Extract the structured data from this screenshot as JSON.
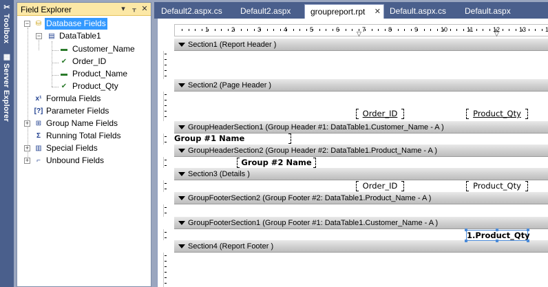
{
  "sidepanel": {
    "tabs": [
      {
        "label": "Toolbox",
        "icon": "toolbox-icon"
      },
      {
        "label": "Server Explorer",
        "icon": "server-explorer-icon"
      }
    ]
  },
  "explorer": {
    "title": "Field Explorer",
    "nodes": {
      "database_fields": "Database Fields",
      "datatable1": "DataTable1",
      "customer_name": "Customer_Name",
      "order_id": "Order_ID",
      "product_name": "Product_Name",
      "product_qty": "Product_Qty",
      "formula_fields": "Formula Fields",
      "parameter_fields": "Parameter Fields",
      "group_name_fields": "Group Name Fields",
      "running_total_fields": "Running Total Fields",
      "special_fields": "Special Fields",
      "unbound_fields": "Unbound Fields"
    },
    "buttons": {
      "dropdown": "▾",
      "pin": "ᚁ",
      "close": "✕"
    }
  },
  "tabs": [
    {
      "label": "Default2.aspx.cs",
      "active": false
    },
    {
      "label": "Default2.aspx",
      "active": false
    },
    {
      "label": "groupreport.rpt",
      "active": true
    },
    {
      "label": "Default.aspx.cs",
      "active": false
    },
    {
      "label": "Default.aspx",
      "active": false
    }
  ],
  "ruler": {
    "numbers": [
      "1",
      "2",
      "3",
      "4",
      "5",
      "6",
      "7",
      "8",
      "9",
      "10",
      "11",
      "12",
      "13",
      "14"
    ]
  },
  "sections": [
    "Section1 (Report Header )",
    "Section2 (Page Header )",
    "GroupHeaderSection1 (Group Header #1: DataTable1.Customer_Name - A )",
    "GroupHeaderSection2 (Group Header #2: DataTable1.Product_Name - A )",
    "Section3 (Details )",
    "GroupFooterSection2 (Group Footer #2: DataTable1.Product_Name - A )",
    "GroupFooterSection1 (Group Footer #1: DataTable1.Customer_Name - A )",
    "Section4 (Report Footer )"
  ],
  "fields": {
    "ph_order_id": "Order_ID",
    "ph_product_qty": "Product_Qty",
    "group1_name": "Group #1 Name",
    "group2_name": "Group #2 Name",
    "det_order_id": "Order_ID",
    "det_product_qty": "Product_Qty",
    "gf1_product_qty": "1.Product_Qty"
  },
  "colors": {
    "selection": "#3399ff",
    "chrome": "#4a5f8c",
    "title_highlight": "#fce8a6"
  }
}
